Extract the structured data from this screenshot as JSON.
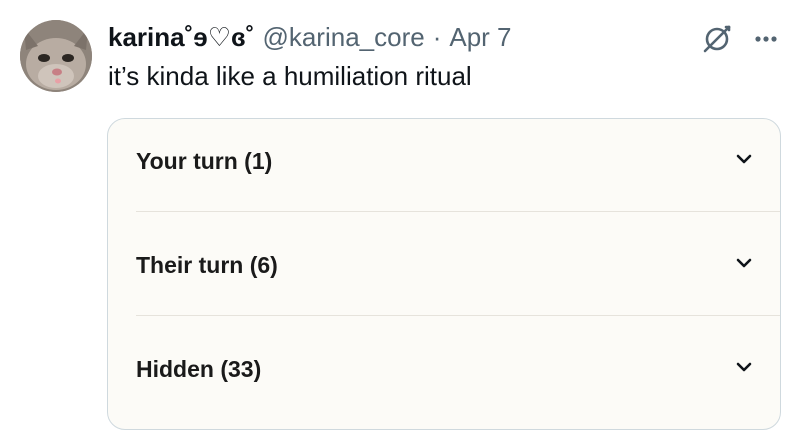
{
  "tweet": {
    "display_name": "karina˚ɘ♡ɞ˚",
    "handle": "@karina_core",
    "separator": "·",
    "date": "Apr 7",
    "text": "it’s kinda like a humiliation ritual",
    "avatar_icon": "cat-avatar",
    "grok_icon": "grok-icon",
    "more_icon": "more-icon"
  },
  "card": {
    "sections": [
      {
        "label": "Your turn (1)",
        "icon": "chevron-down-icon"
      },
      {
        "label": "Their turn (6)",
        "icon": "chevron-down-icon"
      },
      {
        "label": "Hidden (33)",
        "icon": "chevron-down-icon"
      }
    ]
  },
  "colors": {
    "text_primary": "#0f1419",
    "text_secondary": "#536471",
    "card_background": "#fcfbf7",
    "card_border": "#cfd9de"
  }
}
